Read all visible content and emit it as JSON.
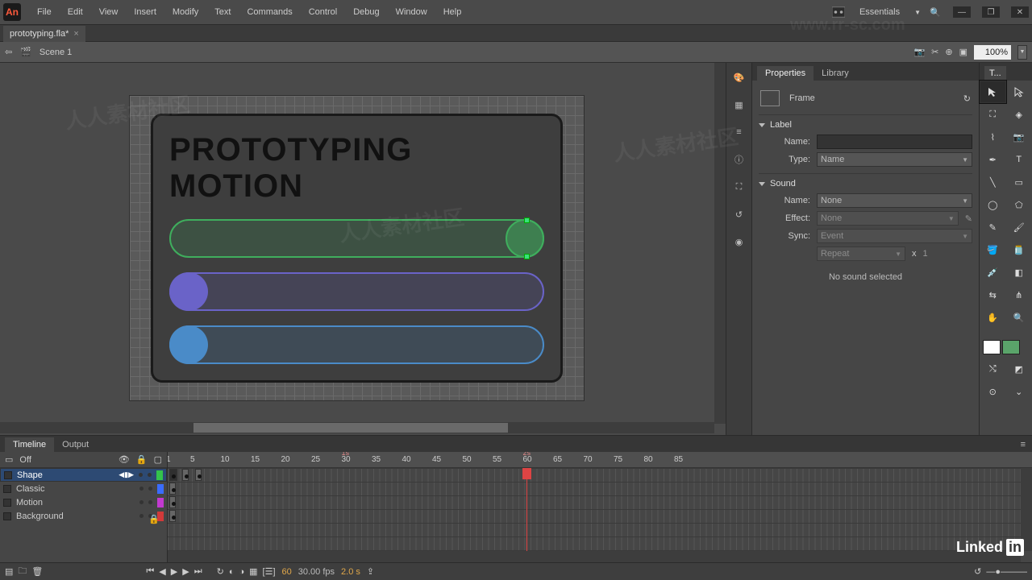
{
  "app": {
    "logo_text": "An"
  },
  "menus": [
    "File",
    "Edit",
    "View",
    "Insert",
    "Modify",
    "Text",
    "Commands",
    "Control",
    "Debug",
    "Window",
    "Help"
  ],
  "workspace_label": "Essentials",
  "document_tab": {
    "name": "prototyping.fla*",
    "close": "×"
  },
  "scene": {
    "name": "Scene 1"
  },
  "zoom": {
    "value": "100%"
  },
  "stage": {
    "heading": "PROTOTYPING MOTION"
  },
  "dock_icons": [
    "palette",
    "grid",
    "list",
    "info",
    "transform",
    "brush",
    "cc"
  ],
  "properties": {
    "tabs": [
      "Properties",
      "Library"
    ],
    "object_type": "Frame",
    "sections": {
      "label": {
        "title": "Label",
        "name_lbl": "Name:",
        "name_val": "",
        "type_lbl": "Type:",
        "type_val": "Name"
      },
      "sound": {
        "title": "Sound",
        "name_lbl": "Name:",
        "name_val": "None",
        "effect_lbl": "Effect:",
        "effect_val": "None",
        "sync_lbl": "Sync:",
        "sync_val": "Event",
        "repeat_val": "Repeat",
        "x_lbl": "x",
        "x_val": "1",
        "note": "No sound selected"
      }
    }
  },
  "toolbox_tab": "T...",
  "timeline": {
    "tabs": [
      "Timeline",
      "Output"
    ],
    "off_label": "Off",
    "layers": [
      {
        "name": "Shape",
        "selected": true,
        "chip": "g"
      },
      {
        "name": "Classic",
        "selected": false,
        "chip": "b"
      },
      {
        "name": "Motion",
        "selected": false,
        "chip": "m"
      },
      {
        "name": "Background",
        "selected": false,
        "chip": "r"
      }
    ],
    "ruler_ticks": [
      1,
      5,
      10,
      15,
      20,
      25,
      30,
      35,
      40,
      45,
      50,
      55,
      60,
      65,
      70,
      75,
      80,
      85
    ],
    "sec_marks": [
      {
        "label": "1s",
        "frame": 30
      },
      {
        "label": "2s",
        "frame": 60
      }
    ],
    "playhead_frame": 60,
    "status": {
      "frame": "60",
      "fps": "30.00 fps",
      "time": "2.0 s"
    }
  },
  "branding": {
    "watermark": "人人素材社区",
    "site": "www.rr-sc.com",
    "linkedin": "Linked"
  }
}
